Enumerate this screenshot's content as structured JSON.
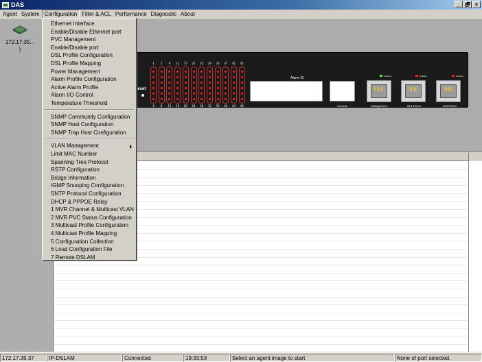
{
  "window": {
    "title": "DAS",
    "controls": [
      "_",
      "🗗",
      "×"
    ]
  },
  "menubar": [
    "Agent",
    "System",
    "Configuration",
    "Filter & ACL",
    "Performance",
    "Diagnostic",
    "About"
  ],
  "agent": {
    "label_line1": "172.17.35...",
    "label_line2": ")"
  },
  "dropdown": {
    "group1": [
      "Ethernet Interface",
      "Enable/Disable Ethernet port",
      "PVC Management",
      "Enable/Disable port",
      "DSL Profile Configuration",
      "DSL Profile Mapping",
      "Power Management",
      "Alarm Profile Configuration",
      "Active Alarm Profile",
      "Alarm I/O Control",
      "Temperature Threshold"
    ],
    "group2": [
      "SNMP Community Configuration",
      "SNMP Host Configuration",
      "SNMP Trap Host Configuration"
    ],
    "group3": [
      "VLAN Management",
      "Limit MAC Number",
      "Spanning Tree Protocol",
      "RSTP Configuration",
      "Bridge Information",
      "IGMP Snooping Configuration",
      "SNTP Protocol Configuration",
      "DHCP & PPPOE Relay",
      "1  MVR Channel & Multicast VLAN",
      "2  MVR PVC Status Configuration",
      "3  Multicast Profile Configuration",
      "4  Multicast Profile Mapping",
      "5  Configuration Collection",
      "6  Load Configuration File",
      "7  Remote DSLAM"
    ]
  },
  "device": {
    "reset_label": "Reset",
    "alarm_label": "Alarm IO",
    "console_label": "Console",
    "ports_top": [
      "1",
      "5",
      "9",
      "13",
      "17",
      "21",
      "25",
      "29",
      "33",
      "37",
      "41",
      "45"
    ],
    "ports_bottom": [
      "4",
      "8",
      "12",
      "16",
      "20",
      "24",
      "28",
      "32",
      "36",
      "40",
      "44",
      "48"
    ],
    "uplinks": [
      {
        "label": "Management",
        "link": "Link/Act",
        "led": "#7ed957"
      },
      {
        "label": "GE1/Fiber1",
        "link": "Link/Act",
        "led": "#ff2020"
      },
      {
        "label": "GE2/Fiber2",
        "link": "Link/Act",
        "led": "#ff2020"
      }
    ]
  },
  "statusbar": {
    "ip": "172.17.35.37",
    "type": "IP-DSLAM",
    "state": "Connected",
    "time": "19:33:53",
    "message": "Select an agent image to start",
    "port": "None of port selected."
  }
}
